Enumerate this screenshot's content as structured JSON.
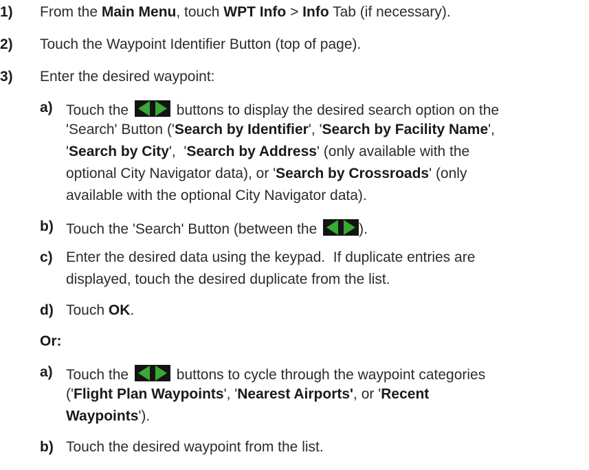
{
  "colors": {
    "arrow_green": "#39a935",
    "arrow_bg": "#141414",
    "text": "#2b2b2b"
  },
  "icons": {
    "arrow_buttons": "left-right-arrows-icon"
  },
  "steps": [
    {
      "num": "1)",
      "t1": "From the ",
      "b1": "Main Menu",
      "t2": ", touch ",
      "b2": "WPT Info",
      "t3": " > ",
      "b3": "Info",
      "t4": " Tab (if necessary)."
    },
    {
      "num": "2)",
      "text": "Touch the Waypoint Identifier Button (top of page)."
    },
    {
      "num": "3)",
      "text": "Enter the desired waypoint:"
    }
  ],
  "search": {
    "a_label": "a)",
    "a_l1_t1": "Touch the",
    "a_l1_t2": "buttons to display the desired search option on the",
    "a_l2_t1": "'Search' Button ('",
    "a_l2_b1": "Search by Identifier",
    "a_l2_t2": "', '",
    "a_l2_b2": "Search by Facility Name",
    "a_l2_t3": "',",
    "a_l3_t1": "'",
    "a_l3_b1": "Search by City",
    "a_l3_t2": "',  '",
    "a_l3_b2": "Search by Address",
    "a_l3_t3": "' (only available with the",
    "a_l4_t1": "optional City Navigator data), or '",
    "a_l4_b1": "Search by Crossroads",
    "a_l4_t2": "' (only",
    "a_l5": "available with the optional City Navigator data).",
    "b_label": "b)",
    "b_t1": "Touch the 'Search' Button (between the",
    "b_t2": ").",
    "c_label": "c)",
    "c_l1": "Enter the desired data using the keypad.  If duplicate entries are",
    "c_l2": "displayed, touch the desired duplicate from the list.",
    "d_label": "d)",
    "d_t1": "Touch ",
    "d_b1": "OK",
    "d_t2": "."
  },
  "or_label": "Or:",
  "alt": {
    "a_label": "a)",
    "a_l1_t1": "Touch the",
    "a_l1_t2": "buttons to cycle through the waypoint categories",
    "a_l2_t1": "('",
    "a_l2_b1": "Flight Plan Waypoints",
    "a_l2_t2": "', '",
    "a_l2_b2": "Nearest Airports'",
    "a_l2_t3": ", or '",
    "a_l2_b3": "Recent",
    "a_l3_b1": "Waypoints",
    "a_l3_t1": "').",
    "b_label": "b)",
    "b_text": "Touch the desired waypoint from the list."
  }
}
